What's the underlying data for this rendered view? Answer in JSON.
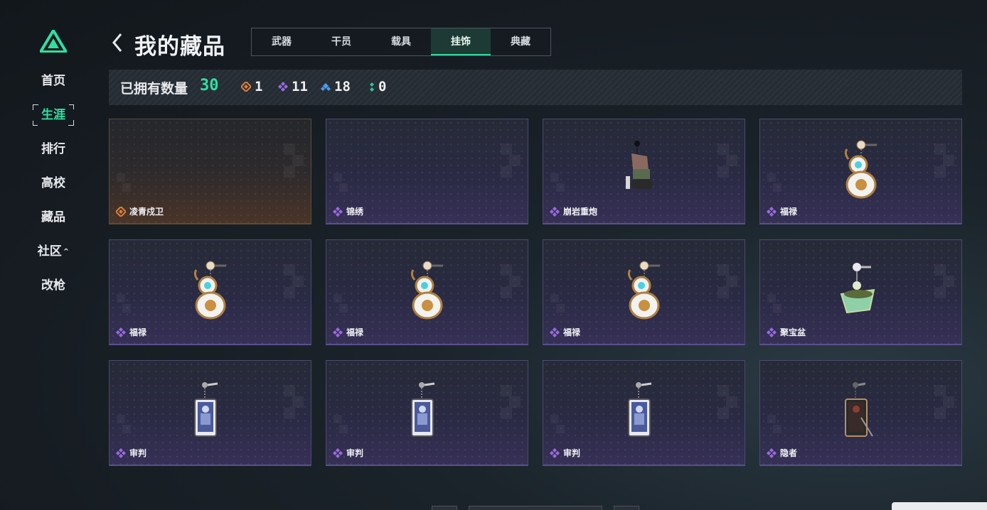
{
  "sidebar": {
    "items": [
      {
        "label": "首页",
        "active": false
      },
      {
        "label": "生涯",
        "active": true
      },
      {
        "label": "排行",
        "active": false
      },
      {
        "label": "高校",
        "active": false
      },
      {
        "label": "藏品",
        "active": false
      },
      {
        "label": "社区",
        "active": false,
        "caret": "^"
      },
      {
        "label": "改枪",
        "active": false
      }
    ]
  },
  "header": {
    "title": "我的藏品",
    "tabs": [
      "武器",
      "干员",
      "载具",
      "挂饰",
      "典藏"
    ],
    "active_tab": "挂饰"
  },
  "stats": {
    "label": "已拥有数量",
    "total": "30",
    "rarities": [
      {
        "count": "1",
        "color": "#e0813a"
      },
      {
        "count": "11",
        "color": "#9a6ae0"
      },
      {
        "count": "18",
        "color": "#4c9cf0"
      },
      {
        "count": "0",
        "color": "#2ec4a0"
      }
    ]
  },
  "cards": [
    {
      "name": "凌青戍卫",
      "rarity": "orange",
      "art": "none"
    },
    {
      "name": "锦绣",
      "rarity": "purple",
      "art": "none"
    },
    {
      "name": "崩岩重炮",
      "rarity": "purple",
      "art": "figure"
    },
    {
      "name": "福禄",
      "rarity": "purple",
      "art": "gourd"
    },
    {
      "name": "福禄",
      "rarity": "purple",
      "art": "gourd"
    },
    {
      "name": "福禄",
      "rarity": "purple",
      "art": "gourd"
    },
    {
      "name": "福禄",
      "rarity": "purple",
      "art": "gourd"
    },
    {
      "name": "聚宝盆",
      "rarity": "purple",
      "art": "bowl"
    },
    {
      "name": "审判",
      "rarity": "purple",
      "art": "tarot"
    },
    {
      "name": "审判",
      "rarity": "purple",
      "art": "tarot"
    },
    {
      "name": "审判",
      "rarity": "purple",
      "art": "tarot"
    },
    {
      "name": "隐者",
      "rarity": "purple",
      "art": "tarot-dark"
    }
  ],
  "colors": {
    "accent": "#2fe0a0",
    "purple_gem": "#9a6ae0",
    "orange_gem": "#e0813a"
  }
}
